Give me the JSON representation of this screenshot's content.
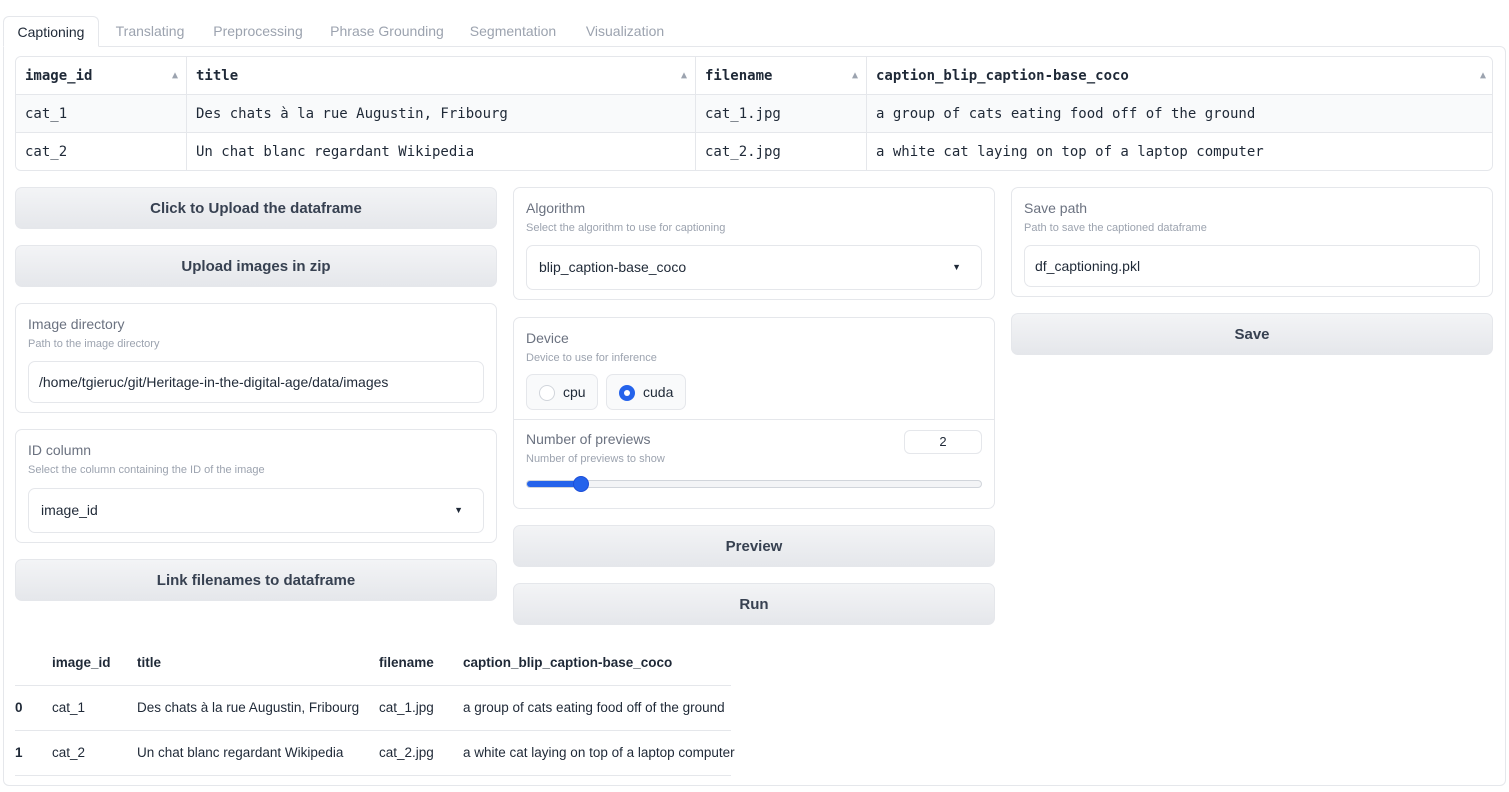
{
  "tabs": [
    "Captioning",
    "Translating",
    "Preprocessing",
    "Phrase Grounding",
    "Segmentation",
    "Visualization"
  ],
  "active_tab": "Captioning",
  "top_table": {
    "columns": [
      "image_id",
      "title",
      "filename",
      "caption_blip_caption-base_coco"
    ],
    "sort_icon": "▲",
    "rows": [
      [
        "cat_1",
        "Des chats à la rue Augustin, Fribourg",
        "cat_1.jpg",
        "a group of cats eating food off of the ground"
      ],
      [
        "cat_2",
        "Un chat blanc regardant Wikipedia",
        "cat_2.jpg",
        "a white cat laying on top of a laptop computer"
      ]
    ]
  },
  "left": {
    "upload_df_label": "Click to Upload the dataframe",
    "upload_zip_label": "Upload images in zip",
    "image_dir": {
      "label": "Image directory",
      "info": "Path to the image directory",
      "value": "/home/tgieruc/git/Heritage-in-the-digital-age/data/images"
    },
    "id_column": {
      "label": "ID column",
      "info": "Select the column containing the ID of the image",
      "value": "image_id"
    },
    "link_label": "Link filenames to dataframe"
  },
  "middle": {
    "algorithm": {
      "label": "Algorithm",
      "info": "Select the algorithm to use for captioning",
      "value": "blip_caption-base_coco"
    },
    "device": {
      "label": "Device",
      "info": "Device to use for inference",
      "options": [
        "cpu",
        "cuda"
      ],
      "selected": "cuda"
    },
    "previews": {
      "label": "Number of previews",
      "info": "Number of previews to show",
      "value": "2",
      "level": 0.12
    },
    "preview_label": "Preview",
    "run_label": "Run"
  },
  "right": {
    "save_path": {
      "label": "Save path",
      "info": "Path to save the captioned dataframe",
      "value": "df_captioning.pkl"
    },
    "save_label": "Save"
  },
  "result_table": {
    "columns": [
      "image_id",
      "title",
      "filename",
      "caption_blip_caption-base_coco"
    ],
    "rows": [
      {
        "index": "0",
        "cells": [
          "cat_1",
          "Des chats à la rue Augustin, Fribourg",
          "cat_1.jpg",
          "a group of cats eating food off of the ground"
        ]
      },
      {
        "index": "1",
        "cells": [
          "cat_2",
          "Un chat blanc regardant Wikipedia",
          "cat_2.jpg",
          "a white cat laying on top of a laptop computer"
        ]
      }
    ]
  },
  "colors": {
    "accent": "#2563eb",
    "border": "#e5e7eb",
    "button_bg": "#e5e7eb"
  }
}
